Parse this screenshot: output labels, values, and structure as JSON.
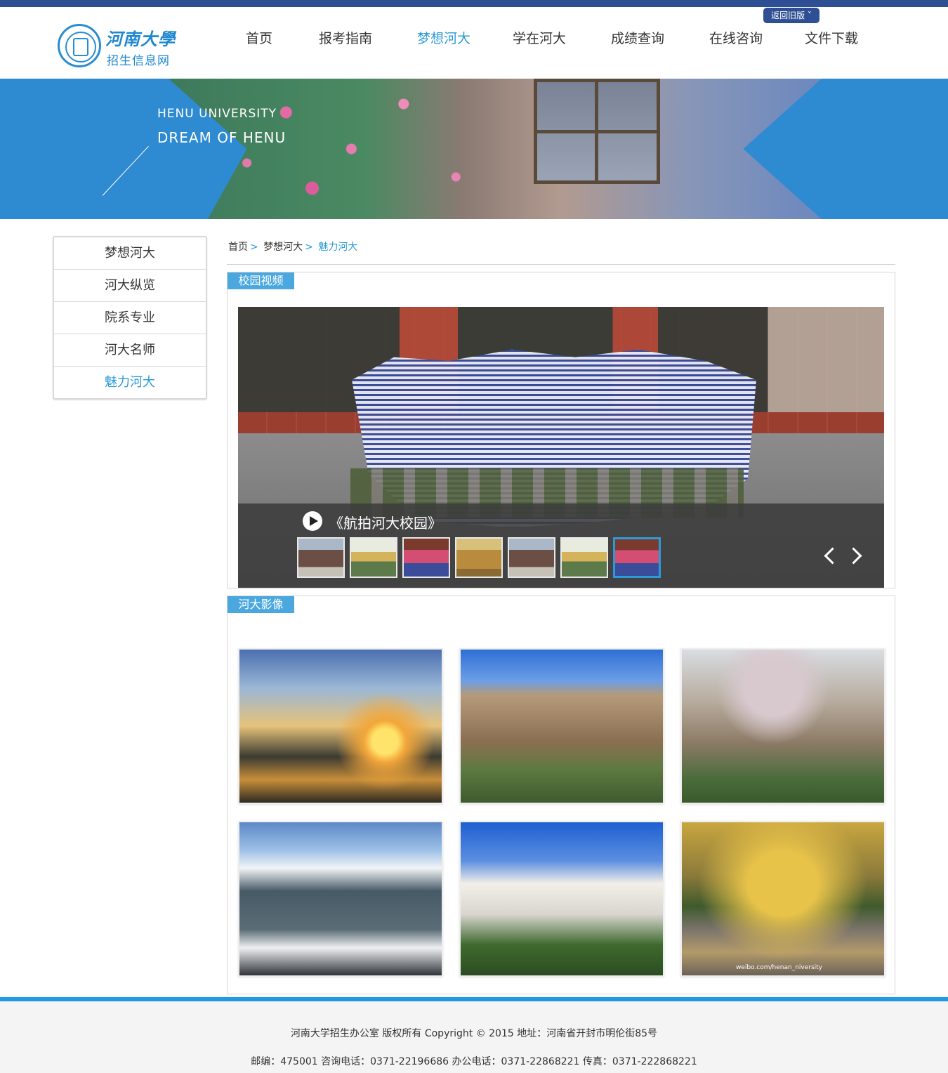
{
  "header": {
    "logo_name": "河南大學",
    "logo_sub": "招生信息网",
    "old_version_label": "返回旧版 ˅"
  },
  "nav": {
    "items": [
      {
        "label": "首页"
      },
      {
        "label": "报考指南"
      },
      {
        "label": "梦想河大",
        "active": true
      },
      {
        "label": "学在河大"
      },
      {
        "label": "成绩查询"
      },
      {
        "label": "在线咨询"
      },
      {
        "label": "文件下载"
      }
    ]
  },
  "banner": {
    "line1": "HENU UNIVERSITY",
    "line2": "DREAM  OF  HENU"
  },
  "sidebar": {
    "items": [
      {
        "label": "梦想河大"
      },
      {
        "label": "河大纵览"
      },
      {
        "label": "院系专业"
      },
      {
        "label": "河大名师"
      },
      {
        "label": "魅力河大",
        "active": true
      }
    ]
  },
  "breadcrumb": {
    "home": "首页",
    "parent": "梦想河大",
    "current": "魅力河大",
    "separator": ">"
  },
  "video_section": {
    "tag": "校园视频",
    "title": "《航拍河大校园》",
    "thumbnail_count": 7,
    "active_thumbnail_index": 6
  },
  "photo_section": {
    "tag": "河大影像",
    "watermark": "weibo.com/henan_niversity"
  },
  "footer": {
    "line1": "河南大学招生办公室 版权所有 Copyright © 2015 地址：河南省开封市明伦街85号",
    "line2": "邮编：475001 咨询电话：0371-22196686 办公电话：0371-22868221 传真：0371-222868221"
  },
  "colors": {
    "accent": "#2a9ad8",
    "top_bar": "#2f4f94",
    "banner_blue": "#2e8ad1",
    "tag_blue": "#4aa8df",
    "footer_line": "#1f9ae0"
  }
}
